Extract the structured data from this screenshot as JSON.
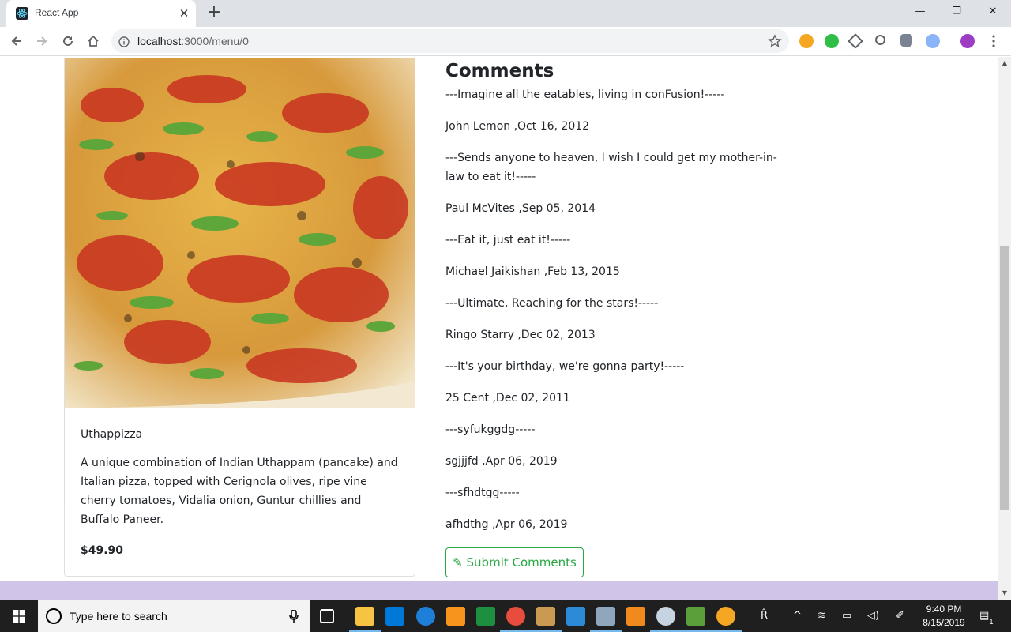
{
  "browser": {
    "tab_title": "React App",
    "new_tab": "+",
    "close_tab": "✕",
    "url_host": "localhost",
    "url_path": ":3000/menu/0",
    "window_controls": {
      "minimize": "—",
      "restore": "❐",
      "close": "✕"
    }
  },
  "dish": {
    "name": "Uthappizza",
    "description": "A unique combination of Indian Uthappam (pancake) and Italian pizza, topped with Cerignola olives, ripe vine cherry tomatoes, Vidalia onion, Guntur chillies and Buffalo Paneer.",
    "price": "$49.90"
  },
  "comments": {
    "title": "Comments",
    "items": [
      {
        "text": "---Imagine all the eatables, living in conFusion!-----",
        "author": "John Lemon ,Oct 16, 2012"
      },
      {
        "text": "---Sends anyone to heaven, I wish I could get my mother-in-law to eat it!-----",
        "author": "Paul McVites ,Sep 05, 2014"
      },
      {
        "text": "---Eat it, just eat it!-----",
        "author": "Michael Jaikishan ,Feb 13, 2015"
      },
      {
        "text": "---Ultimate, Reaching for the stars!-----",
        "author": "Ringo Starry ,Dec 02, 2013"
      },
      {
        "text": "---It's your birthday, we're gonna party!-----",
        "author": "25 Cent ,Dec 02, 2011"
      },
      {
        "text": "---syfukggdg-----",
        "author": "sgjjjfd ,Apr 06, 2019"
      },
      {
        "text": "---sfhdtgg-----",
        "author": "afhdthg ,Apr 06, 2019"
      }
    ],
    "submit_label": "Submit Comments"
  },
  "taskbar": {
    "search_placeholder": "Type here to search",
    "time": "9:40 PM",
    "date": "8/15/2019",
    "notification_count": "1"
  },
  "colors": {
    "success": "#28a745",
    "footer": "#d1c4e9",
    "taskbar": "#1f1f1f"
  }
}
